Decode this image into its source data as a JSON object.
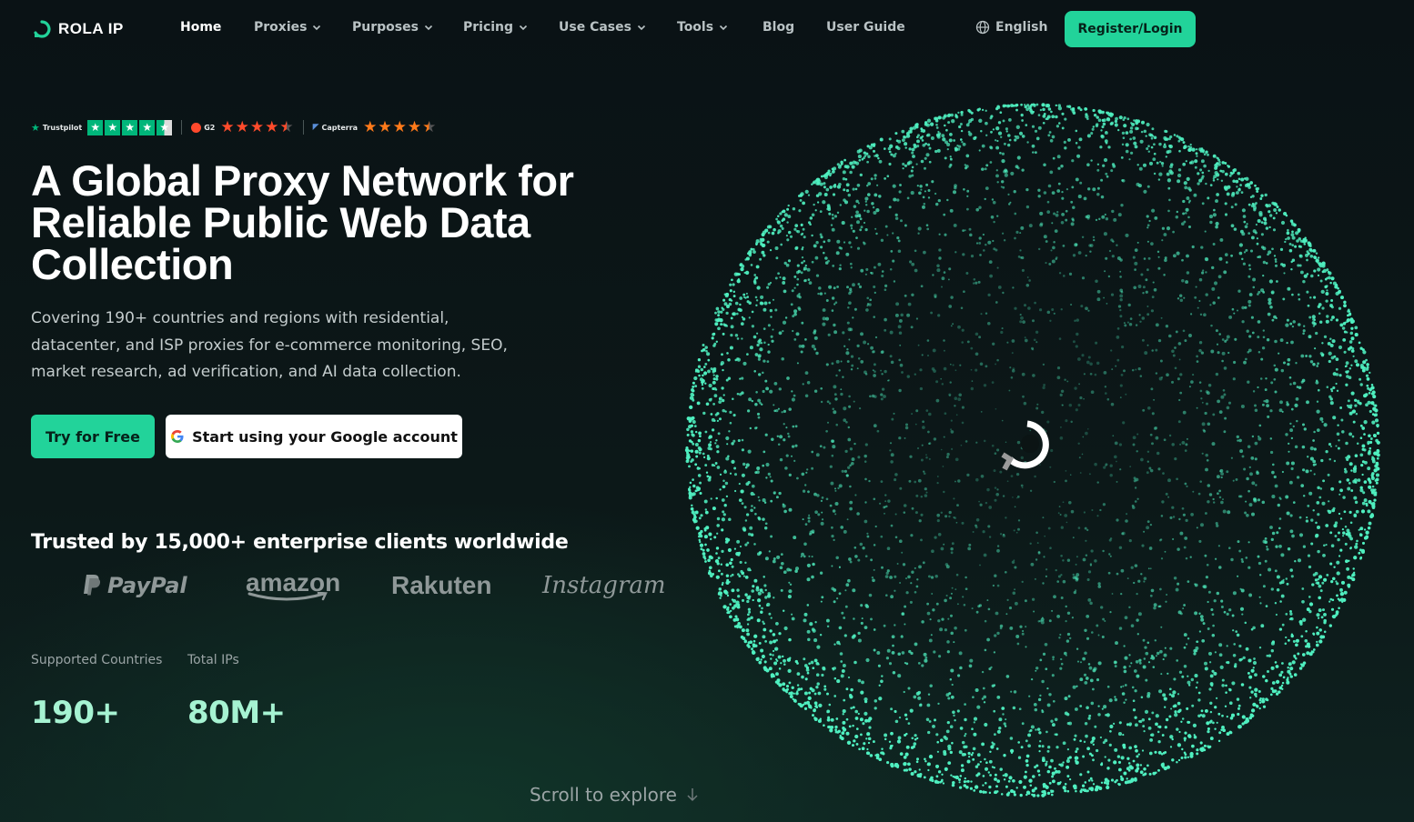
{
  "brand": {
    "name": "ROLA IP"
  },
  "nav": {
    "items": [
      {
        "label": "Home",
        "dropdown": false,
        "active": true
      },
      {
        "label": "Proxies",
        "dropdown": true
      },
      {
        "label": "Purposes",
        "dropdown": true
      },
      {
        "label": "Pricing",
        "dropdown": true
      },
      {
        "label": "Use Cases",
        "dropdown": true
      },
      {
        "label": "Tools",
        "dropdown": true
      },
      {
        "label": "Blog",
        "dropdown": false
      },
      {
        "label": "User Guide",
        "dropdown": false
      }
    ],
    "language": "English",
    "register_label": "Register/Login"
  },
  "ratings": [
    {
      "platform": "Trustpilot",
      "stars": 4.5
    },
    {
      "platform": "G2",
      "stars": 4.5
    },
    {
      "platform": "Capterra",
      "stars": 4.5
    }
  ],
  "hero": {
    "title": "A Global Proxy Network for Reliable Public Web Data Collection",
    "subtitle": "Covering 190+ countries and regions with residential, datacenter, and ISP proxies for e-commerce monitoring, SEO, market research, ad verification, and AI data collection.",
    "try_label": "Try for Free",
    "google_label": "Start using your Google account"
  },
  "trusted": {
    "heading": "Trusted by 15,000+ enterprise clients worldwide",
    "brands": [
      "PayPal",
      "amazon",
      "Rakuten",
      "Instagram"
    ]
  },
  "stats": [
    {
      "label": "Supported Countries",
      "value": "190+"
    },
    {
      "label": "Total IPs",
      "value": "80M+"
    }
  ],
  "scroll_hint": "Scroll to explore",
  "colors": {
    "accent": "#22d39a",
    "background": "#0b1414",
    "stat_value": "#a6f3d2",
    "globe_dots": "#4ff0c0"
  },
  "icons": [
    "logo-icon",
    "chevron-down-icon",
    "globe-icon",
    "google-icon",
    "star-icon",
    "arrow-down-icon",
    "loading-spinner-icon",
    "paypal-icon"
  ]
}
